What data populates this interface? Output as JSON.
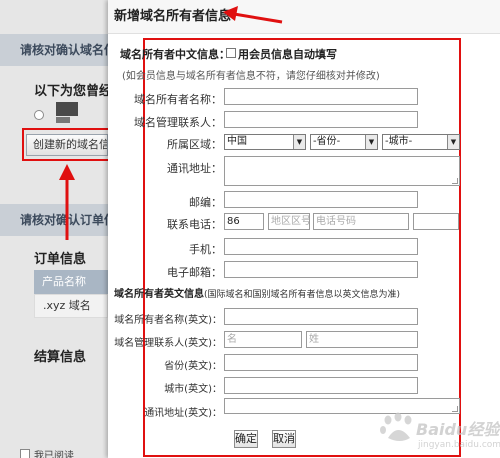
{
  "background": {
    "bar1": "请核对确认域名信息",
    "prev_info": "以下为您曾经",
    "create_button": "创建新的域名信息",
    "bar2": "请核对确认订单信息",
    "order_info": "订单信息",
    "product_name_header": "产品名称",
    "product_row": ".xyz 域名",
    "settlement_info": "结算信息",
    "agree_text": "我已阅读"
  },
  "dialog": {
    "title": "新增域名所有者信息",
    "cn_section": "域名所有者中文信息：",
    "autofill_label": "用会员信息自动填写",
    "cn_note": "(如会员信息与域名所有者信息不符，请您仔细核对并修改)",
    "fields": {
      "owner_name": "域名所有者名称：",
      "admin": "域名管理联系人：",
      "region": "所属区域：",
      "address": "通讯地址：",
      "zip": "邮编：",
      "phone": "联系电话：",
      "mobile": "手机：",
      "email": "电子邮箱："
    },
    "region_country": "中国",
    "region_province": "-省份-",
    "region_city": "-城市-",
    "phone_code": "86",
    "phone_area_placeholder": "地区区号",
    "phone_number_placeholder": "电话号码",
    "en_section": "域名所有者英文信息",
    "en_note": "(国际域名和国别域名所有者信息以英文信息为准)",
    "en_fields": {
      "owner_name": "域名所有者名称(英文)：",
      "admin": "域名管理联系人(英文)：",
      "province": "省份(英文)：",
      "city": "城市(英文)：",
      "address": "通讯地址(英文)："
    },
    "first_name_placeholder": "名",
    "last_name_placeholder": "姓",
    "confirm": "确定",
    "cancel": "取消"
  },
  "watermark": "Baidu经验",
  "watermark_url": "jingyan.baidu.com",
  "colors": {
    "annotation": "#e01010",
    "accent": "#3b6fb6"
  }
}
